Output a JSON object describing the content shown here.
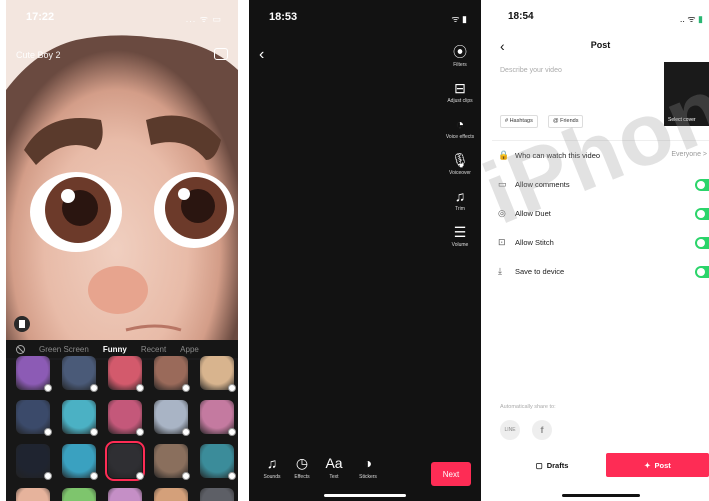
{
  "phone1": {
    "time": "17:22",
    "status_icons": "... ᯤ ▭",
    "effect_name": "Cute Boy 2",
    "categories": [
      "Green Screen",
      "Funny",
      "Recent",
      "Appe"
    ],
    "active_category": "Funny",
    "tile_colors": [
      "#8c5bb5",
      "#4a5a78",
      "#d35a6c",
      "#9a6a5a",
      "#d8b48e",
      "#3b4a6a",
      "#4bb1c4",
      "#c4587a",
      "#a9b4c5",
      "#c47aa0",
      "#1f2430",
      "#3aa1c0",
      "#2f2f33",
      "#8a6f5d",
      "#3b8c9a",
      "#e6b39c",
      "#7ec56d",
      "#c58fc6",
      "#d4a07a",
      "#5d5f66"
    ]
  },
  "phone2": {
    "time": "18:53",
    "status_icons": "ᯤ ▮",
    "back_icon": "‹",
    "tools": [
      {
        "label": "Filters",
        "icon": "⦿"
      },
      {
        "label": "Adjust clips",
        "icon": "⊟"
      },
      {
        "label": "Voice effects",
        "icon": "◔"
      },
      {
        "label": "Voiceover",
        "icon": "🎙"
      },
      {
        "label": "Trim",
        "icon": "♫"
      },
      {
        "label": "Volume",
        "icon": "☰"
      }
    ],
    "bottom_tools": [
      {
        "label": "Sounds",
        "icon": "♫"
      },
      {
        "label": "Effects",
        "icon": "◷"
      },
      {
        "label": "Text",
        "icon": "Aa"
      },
      {
        "label": "Stickers",
        "icon": "◑"
      }
    ],
    "next_label": "Next"
  },
  "phone3": {
    "time": "18:54",
    "status_icons": ".. ᯤ",
    "battery": "▮",
    "back_icon": "‹",
    "title": "Post",
    "describe_placeholder": "Describe your video",
    "select_cover": "Select cover",
    "chips": [
      "# Hashtags",
      "@ Friends"
    ],
    "settings": [
      {
        "label": "Who can watch this video",
        "value": "Everyone >",
        "icon": "🔒"
      },
      {
        "label": "Allow comments",
        "icon": "▭"
      },
      {
        "label": "Allow Duet",
        "icon": "◎"
      },
      {
        "label": "Allow Stitch",
        "icon": "⊡"
      },
      {
        "label": "Save to device",
        "icon": "⤓"
      }
    ],
    "share_label": "Automatically share to:",
    "share_icons": [
      "LINE",
      "f"
    ],
    "drafts_label": "Drafts",
    "post_label": "Post"
  },
  "watermark": "iPhone"
}
